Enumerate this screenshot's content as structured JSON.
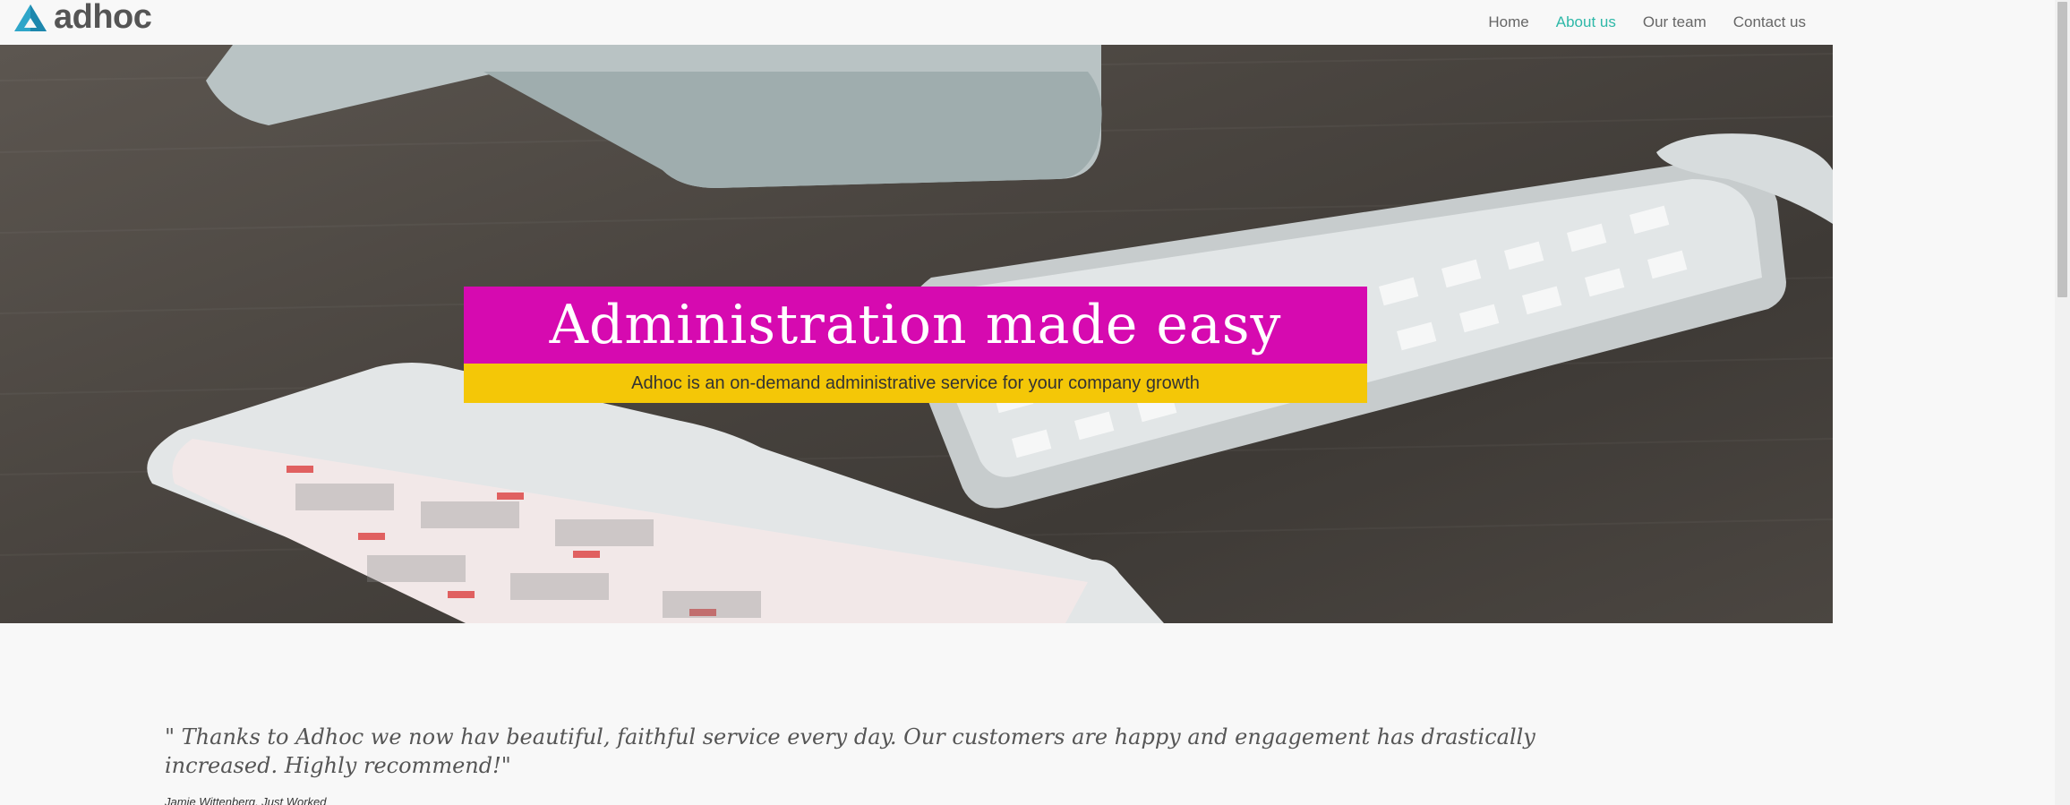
{
  "brand": {
    "logo_text": "adhoc",
    "logo_icon": "triangle-logo-icon",
    "accent_color": "#2eb8a8"
  },
  "nav": {
    "items": [
      {
        "label": "Home",
        "active": false
      },
      {
        "label": "About us",
        "active": true
      },
      {
        "label": "Our team",
        "active": false
      },
      {
        "label": "Contact us",
        "active": false
      }
    ]
  },
  "hero": {
    "title": "Administration made easy",
    "subtitle": "Adhoc is an on-demand administrative service for your company growth",
    "title_bg": "#d60ab0",
    "subtitle_bg": "#f4c707"
  },
  "testimonial": {
    "quote": "\" Thanks to Adhoc we now hav beautiful, faithful service every day. Our customers are happy and engagement has drastically increased. Highly recommend!\"",
    "author": "Jamie Wittenberg, Just Worked"
  }
}
